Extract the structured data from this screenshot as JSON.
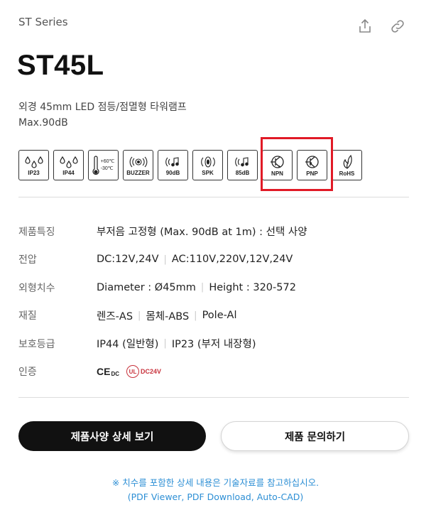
{
  "series": "ST Series",
  "model": "ST45L",
  "description": [
    "외경 45mm LED 점등/점멸형 타워램프",
    "Max.90dB"
  ],
  "badges": [
    {
      "icon": "ip23-drops-icon",
      "label": "IP23"
    },
    {
      "icon": "ip44-drops-icon",
      "label": "IP44"
    },
    {
      "icon": "thermometer-icon",
      "label": "",
      "temp_high": "+60℃",
      "temp_low": "-30℃"
    },
    {
      "icon": "buzzer-icon",
      "label": "BUZZER"
    },
    {
      "icon": "sound-90db-icon",
      "label": "90dB"
    },
    {
      "icon": "speaker-icon",
      "label": "SPK"
    },
    {
      "icon": "sound-85db-icon",
      "label": "85dB"
    },
    {
      "icon": "npn-transistor-icon",
      "label": "NPN"
    },
    {
      "icon": "pnp-transistor-icon",
      "label": "PNP"
    },
    {
      "icon": "rohs-leaf-icon",
      "label": "RoHS"
    }
  ],
  "specs": [
    {
      "key": "제품특징",
      "values": [
        "부저음 고정형 (Max. 90dB at 1m) : 선택 사양"
      ]
    },
    {
      "key": "전압",
      "values": [
        "DC:12V,24V",
        "AC:110V,220V,12V,24V"
      ]
    },
    {
      "key": "외형치수",
      "values": [
        "Diameter : Ø45mm",
        "Height : 320-572"
      ]
    },
    {
      "key": "재질",
      "values": [
        "렌즈-AS",
        "몸체-ABS",
        "Pole-Al"
      ]
    },
    {
      "key": "보호등급",
      "values": [
        "IP44 (일반형)",
        "IP23 (부저 내장형)"
      ]
    },
    {
      "key": "인증",
      "values": []
    }
  ],
  "certs": {
    "ce_text": "CE",
    "ce_sub": "DC",
    "ul_text": "UL",
    "ul_sub": "DC24V"
  },
  "buttons": {
    "spec_detail": "제품사양 상세 보기",
    "inquiry": "제품 문의하기"
  },
  "note": [
    "※ 치수를 포함한 상세 내용은 기술자료를 참고하십시오.",
    "(PDF Viewer, PDF Download, Auto-CAD)"
  ],
  "colors": {
    "highlight": "#e11a26",
    "note": "#2d8fd5",
    "primary_button": "#111111"
  }
}
